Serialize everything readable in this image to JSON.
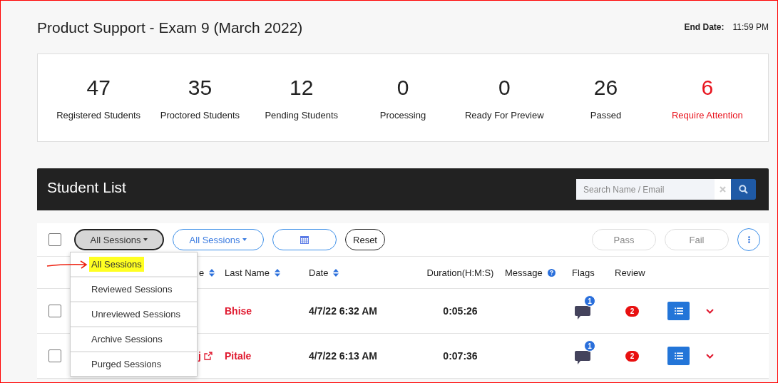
{
  "exam": {
    "title": "Product Support - Exam 9 (March 2022)",
    "end_date_label": "End Date:",
    "end_date_value": "11:59 PM"
  },
  "stats": [
    {
      "value": "47",
      "label": "Registered Students",
      "kind": "normal"
    },
    {
      "value": "35",
      "label": "Proctored Students",
      "kind": "normal"
    },
    {
      "value": "12",
      "label": "Pending Students",
      "kind": "normal"
    },
    {
      "value": "0",
      "label": "Processing",
      "kind": "normal"
    },
    {
      "value": "0",
      "label": "Ready For Preview",
      "kind": "normal"
    },
    {
      "value": "26",
      "label": "Passed",
      "kind": "normal"
    },
    {
      "value": "6",
      "label": "Require Attention",
      "kind": "alert"
    }
  ],
  "student_list": {
    "title": "Student List",
    "search": {
      "placeholder": "Search Name / Email"
    }
  },
  "toolbar": {
    "select_all_checked": false,
    "session_filter": "All Sessions",
    "review_filter": "All Sessions",
    "reset": "Reset",
    "pass": "Pass",
    "fail": "Fail"
  },
  "session_menu": [
    {
      "label": "All Sessions",
      "selected": true
    },
    {
      "label": "Reviewed Sessions",
      "selected": false
    },
    {
      "label": "Unreviewed Sessions",
      "selected": false
    },
    {
      "label": "Archive Sessions",
      "selected": false
    },
    {
      "label": "Purged Sessions",
      "selected": false
    }
  ],
  "columns": {
    "first_name": "e",
    "last_name": "Last Name",
    "date": "Date",
    "duration": "Duration(H:M:S)",
    "message": "Message",
    "flags": "Flags",
    "review": "Review"
  },
  "rows": [
    {
      "checked": false,
      "last_name": "Bhise",
      "date": "4/7/22 6:32 AM",
      "duration": "0:05:26",
      "flags": "1",
      "review": "2"
    },
    {
      "checked": false,
      "first_name": "j",
      "last_name": "Pitale",
      "date": "4/7/22 6:13 AM",
      "duration": "0:07:36",
      "flags": "1",
      "review": "2"
    }
  ]
}
